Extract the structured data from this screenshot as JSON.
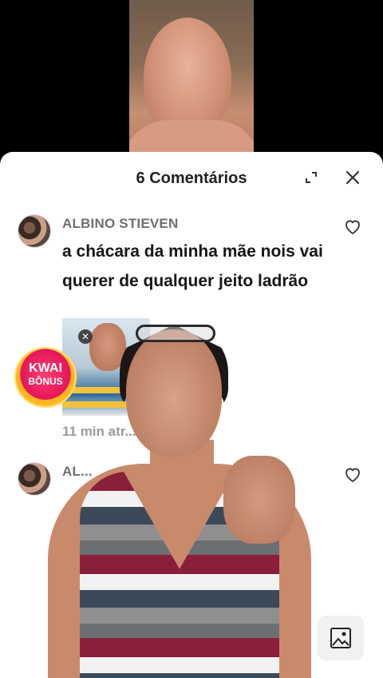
{
  "header": {
    "title": "6 Comentários"
  },
  "comments": [
    {
      "author": "ALBINO STIEVEN",
      "text": "a chácara da minha mãe nois vai querer de qualquer jeito ladrão",
      "meta": "11 min atr... ...nder"
    },
    {
      "author": "AL..."
    }
  ],
  "badge": {
    "line1": "KWAI",
    "line2": "BÔNUS"
  },
  "icons": {
    "expand": "expand-icon",
    "close": "close-icon",
    "like": "heart-icon",
    "image": "image-icon"
  },
  "colors": {
    "sheet_bg": "#ffffff",
    "title": "#222222",
    "author": "#6f6f6f",
    "meta": "#9a9a9a",
    "badge": "#e4155c"
  }
}
